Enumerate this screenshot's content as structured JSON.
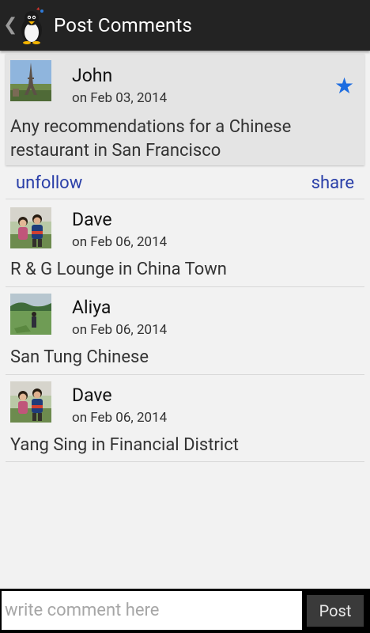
{
  "actionbar": {
    "back_glyph": "❮",
    "title": "Post Comments"
  },
  "post": {
    "author": "John",
    "date": "on Feb 03, 2014",
    "text": "Any recommendations for a Chinese restaurant in San Francisco",
    "starred_icon": "star-icon",
    "star_glyph": "★",
    "star_color": "#1e6de0"
  },
  "actions": {
    "unfollow_label": "unfollow",
    "share_label": "share",
    "link_color": "#2a3fa8"
  },
  "comments": [
    {
      "author": "Dave",
      "date": "on Feb 06, 2014",
      "text": "R & G Lounge in China Town"
    },
    {
      "author": "Aliya",
      "date": "on Feb 06, 2014",
      "text": "San Tung Chinese"
    },
    {
      "author": "Dave",
      "date": "on Feb 06, 2014",
      "text": "Yang Sing in Financial District"
    }
  ],
  "composer": {
    "placeholder": "write comment here",
    "post_label": "Post"
  }
}
